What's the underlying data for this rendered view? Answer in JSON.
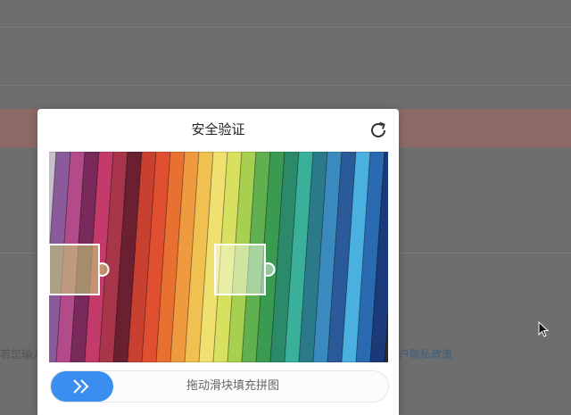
{
  "dialog": {
    "title": "安全验证",
    "refresh_icon": "refresh-icon",
    "slider_hint": "拖动滑块填充拼图",
    "slider_icon": "double-chevron-right-icon",
    "accent_color": "#3a8ef0"
  },
  "background": {
    "left_text": "若您输入",
    "right_link": "户隐私政策"
  }
}
